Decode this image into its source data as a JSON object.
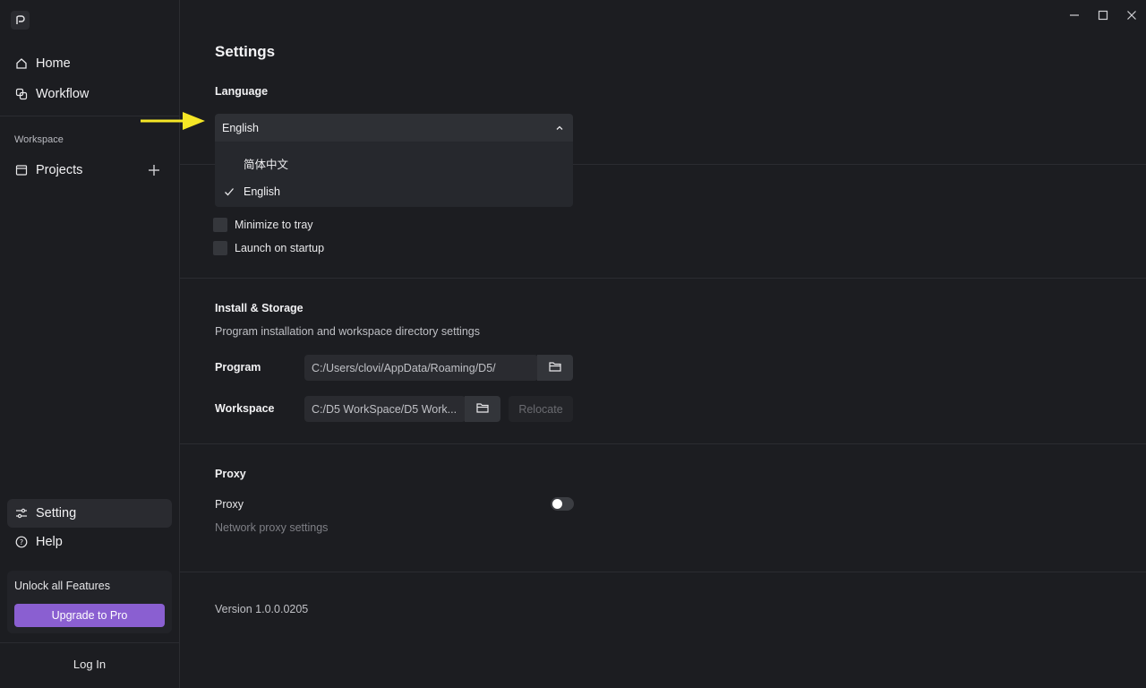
{
  "sidebar": {
    "nav": [
      {
        "label": "Home",
        "icon": "home-icon"
      },
      {
        "label": "Workflow",
        "icon": "workflow-icon"
      }
    ],
    "workspace_label": "Workspace",
    "projects_label": "Projects",
    "setting_label": "Setting",
    "help_label": "Help",
    "upgrade_card": {
      "title": "Unlock all Features",
      "button": "Upgrade to Pro"
    },
    "login_label": "Log In"
  },
  "main": {
    "title": "Settings",
    "language": {
      "heading": "Language",
      "selected": "English",
      "options": [
        "简体中文",
        "English"
      ]
    },
    "general": {
      "minimize_label": "Minimize to tray",
      "launch_label": "Launch on startup"
    },
    "install": {
      "heading": "Install & Storage",
      "description": "Program installation and workspace directory settings",
      "program_label": "Program",
      "program_path": "C:/Users/clovi/AppData/Roaming/D5/",
      "workspace_label": "Workspace",
      "workspace_path": "C:/D5 WorkSpace/D5 Work...",
      "relocate_label": "Relocate"
    },
    "proxy": {
      "heading": "Proxy",
      "label": "Proxy",
      "description": "Network proxy settings",
      "enabled": false
    },
    "version": "Version 1.0.0.0205"
  },
  "colors": {
    "accent": "#8a5fd1",
    "annotation_arrow": "#f5e626"
  }
}
